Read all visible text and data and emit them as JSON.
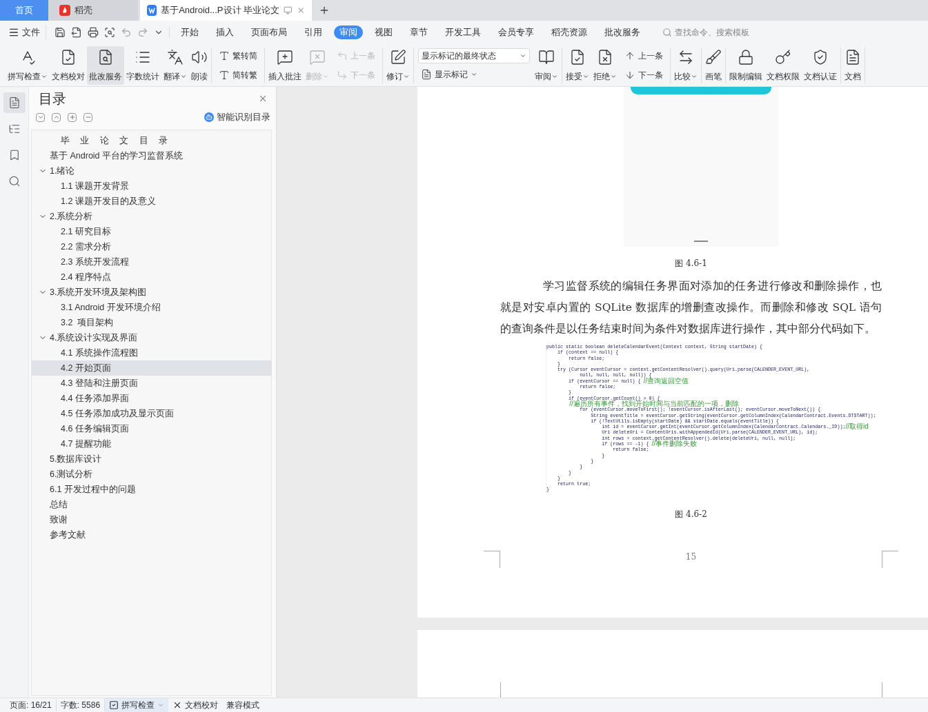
{
  "tabs": [
    {
      "kind": "home",
      "label": "首页",
      "selected": false
    },
    {
      "kind": "app",
      "label": "稻壳",
      "selected": false
    },
    {
      "kind": "document",
      "label": "基于Android...P设计 毕业论文",
      "selected": true
    }
  ],
  "menu": {
    "file": "文件",
    "tabs": [
      {
        "label": "开始",
        "selected": false
      },
      {
        "label": "插入",
        "selected": false
      },
      {
        "label": "页面布局",
        "selected": false
      },
      {
        "label": "引用",
        "selected": false
      },
      {
        "label": "审阅",
        "selected": true
      },
      {
        "label": "视图",
        "selected": false
      },
      {
        "label": "章节",
        "selected": false
      },
      {
        "label": "开发工具",
        "selected": false
      },
      {
        "label": "会员专享",
        "selected": false
      },
      {
        "label": "稻壳资源",
        "selected": false
      },
      {
        "label": "批改服务",
        "selected": false
      }
    ],
    "search_placeholder": "查找命令、搜索模板"
  },
  "ribbon": [
    [
      {
        "kind": "large",
        "label": "拼写检查",
        "dropdown": true,
        "disabled": false,
        "selected": false
      },
      {
        "kind": "large",
        "label": "文档校对",
        "dropdown": false,
        "disabled": false,
        "selected": false
      },
      {
        "kind": "large",
        "label": "批改服务",
        "dropdown": false,
        "disabled": false,
        "selected": true
      },
      {
        "kind": "large",
        "label": "字数统计",
        "dropdown": false,
        "disabled": false,
        "selected": false
      },
      {
        "kind": "large",
        "label": "翻译",
        "dropdown": true,
        "disabled": false,
        "selected": false
      },
      {
        "kind": "large",
        "label": "朗读",
        "dropdown": false,
        "disabled": false,
        "selected": false
      }
    ],
    [
      {
        "kind": "stack",
        "items": [
          {
            "kind": "small",
            "label": "繁转简",
            "dropdown": false,
            "disabled": false
          },
          {
            "kind": "small",
            "label": "简转繁",
            "dropdown": false,
            "disabled": false
          }
        ]
      }
    ],
    [
      {
        "kind": "large",
        "label": "插入批注",
        "dropdown": false,
        "disabled": false,
        "selected": false
      },
      {
        "kind": "large",
        "label": "删除",
        "dropdown": true,
        "disabled": true,
        "selected": false
      },
      {
        "kind": "stack",
        "items": [
          {
            "kind": "small",
            "label": "上一条",
            "dropdown": false,
            "disabled": true
          },
          {
            "kind": "small",
            "label": "下一条",
            "dropdown": false,
            "disabled": true
          }
        ]
      }
    ],
    [
      {
        "kind": "large",
        "label": "修订",
        "dropdown": true,
        "disabled": false,
        "selected": false
      }
    ],
    [
      {
        "kind": "stack",
        "items": [
          {
            "kind": "select",
            "value": "显示标记的最终状态"
          },
          {
            "kind": "small",
            "label": "显示标记",
            "dropdown": true,
            "disabled": false
          }
        ]
      },
      {
        "kind": "large",
        "label": "审阅",
        "dropdown": true,
        "disabled": false,
        "selected": false
      }
    ],
    [
      {
        "kind": "large",
        "label": "接受",
        "dropdown": true,
        "disabled": false,
        "selected": false
      },
      {
        "kind": "large",
        "label": "拒绝",
        "dropdown": true,
        "disabled": false,
        "selected": false
      },
      {
        "kind": "stack",
        "items": [
          {
            "kind": "small",
            "label": "上一条",
            "dropdown": false,
            "disabled": false
          },
          {
            "kind": "small",
            "label": "下一条",
            "dropdown": false,
            "disabled": false
          }
        ]
      }
    ],
    [
      {
        "kind": "large",
        "label": "比较",
        "dropdown": true,
        "disabled": false,
        "selected": false
      }
    ],
    [
      {
        "kind": "large",
        "label": "画笔",
        "dropdown": false,
        "disabled": false,
        "selected": false
      }
    ],
    [
      {
        "kind": "large",
        "label": "限制编辑",
        "dropdown": false,
        "disabled": false,
        "selected": false
      },
      {
        "kind": "large",
        "label": "文档权限",
        "dropdown": false,
        "disabled": false,
        "selected": false
      },
      {
        "kind": "large",
        "label": "文档认证",
        "dropdown": false,
        "disabled": false,
        "selected": false
      }
    ],
    [
      {
        "kind": "large",
        "label": "文档",
        "dropdown": false,
        "disabled": false,
        "selected": false
      }
    ]
  ],
  "sidebar_icons": [
    {
      "selected": true
    },
    {
      "selected": false
    },
    {
      "selected": false
    },
    {
      "selected": false
    }
  ],
  "toc": {
    "title": "目录",
    "smart_link": "智能识别目录",
    "items": [
      {
        "kind": "title",
        "label": "毕 业 论 文 目 录",
        "selected": false
      },
      {
        "kind": "entry",
        "label": "基于 Android 平台的学习监督系统",
        "selected": false
      },
      {
        "kind": "entry",
        "label": "1.绪论",
        "selected": false,
        "expanded": true,
        "children": [
          {
            "kind": "entry",
            "label": "1.1 课题开发背景",
            "selected": false
          },
          {
            "kind": "entry",
            "label": "1.2 课题开发目的及意义",
            "selected": false
          }
        ]
      },
      {
        "kind": "entry",
        "label": "2.系统分析",
        "selected": false,
        "expanded": true,
        "children": [
          {
            "kind": "entry",
            "label": "2.1 研究目标",
            "selected": false
          },
          {
            "kind": "entry",
            "label": "2.2 需求分析",
            "selected": false
          },
          {
            "kind": "entry",
            "label": "2.3 系统开发流程",
            "selected": false
          },
          {
            "kind": "entry",
            "label": "2.4 程序特点",
            "selected": false
          }
        ]
      },
      {
        "kind": "entry",
        "label": "3.系统开发环境及架构图",
        "selected": false,
        "expanded": true,
        "children": [
          {
            "kind": "entry",
            "label": "3.1 Android 开发环境介绍",
            "selected": false
          },
          {
            "kind": "entry",
            "label": "3.2  项目架构",
            "selected": false
          }
        ]
      },
      {
        "kind": "entry",
        "label": "4.系统设计实现及界面",
        "selected": false,
        "expanded": true,
        "children": [
          {
            "kind": "entry",
            "label": "4.1 系统操作流程图",
            "selected": false
          },
          {
            "kind": "entry",
            "label": "4.2 开始页面",
            "selected": true
          },
          {
            "kind": "entry",
            "label": "4.3 登陆和注册页面",
            "selected": false
          },
          {
            "kind": "entry",
            "label": "4.4 任务添加界面",
            "selected": false
          },
          {
            "kind": "entry",
            "label": "4.5 任务添加成功及显示页面",
            "selected": false
          },
          {
            "kind": "entry",
            "label": "4.6 任务编辑页面",
            "selected": false
          },
          {
            "kind": "entry",
            "label": "4.7 提醒功能",
            "selected": false
          }
        ]
      },
      {
        "kind": "entry",
        "label": "5.数据库设计",
        "selected": false
      },
      {
        "kind": "entry",
        "label": "6.测试分析",
        "selected": false
      },
      {
        "kind": "entry",
        "label": "6.1 开发过程中的问题",
        "selected": false
      },
      {
        "kind": "entry",
        "label": "总结",
        "selected": false
      },
      {
        "kind": "entry",
        "label": "致谢",
        "selected": false
      },
      {
        "kind": "entry",
        "label": "参考文献",
        "selected": false
      }
    ]
  },
  "document": {
    "caption_1": "图 4.6-1",
    "paragraph": "学习监督系统的编辑任务界面对添加的任务进行修改和删除操作，也就是对安卓内置的 SQLite 数据库的增删查改操作。而删除和修改 SQL 语句的查询条件是以任务结束时间为条件对数据库进行操作，其中部分代码如下。",
    "code": [
      {
        "code": "public static boolean deleteCalendarEvent(Context context, String startDate) {"
      },
      {
        "code": "    if (context == null) {"
      },
      {
        "code": "        return false;"
      },
      {
        "code": "    }"
      },
      {
        "code": "    try (Cursor eventCursor = context.getContentResolver().query(Uri.parse(CALENDER_EVENT_URL),"
      },
      {
        "code": "            null, null, null, null)) {"
      },
      {
        "code": "        if (eventCursor == null) { ",
        "comment": "//查询返回空值"
      },
      {
        "code": "            return false;"
      },
      {
        "code": "        }"
      },
      {
        "code": "        if (eventCursor.getCount() > 0) {"
      },
      {
        "comment": "            //遍历所有事件，找到开始时间与当前匹配的一项，删除"
      },
      {
        "code": "            for (eventCursor.moveToFirst(); !eventCursor.isAfterLast(); eventCursor.moveToNext()) {"
      },
      {
        "code": "                String eventTitle = eventCursor.getString(eventCursor.getColumnIndex(CalendarContract.Events.DTSTART));"
      },
      {
        "code": "                if (!TextUtils.isEmpty(startDate) && startDate.equals(eventTitle)) {"
      },
      {
        "code": "                    int id = eventCursor.getInt(eventCursor.getColumnIndex(CalendarContract.Calendars._ID));",
        "comment": "//取得id"
      },
      {
        "code": "                    Uri deleteUri = ContentUris.withAppendedId(Uri.parse(CALENDER_EVENT_URL), id);"
      },
      {
        "code": "                    int rows = context.getContentResolver().delete(deleteUri, null, null);"
      },
      {
        "code": "                    if (rows == -1) { ",
        "comment": "//事件删除失败"
      },
      {
        "code": "                        return false;"
      },
      {
        "code": "                    }"
      },
      {
        "code": "                }"
      },
      {
        "code": "            }"
      },
      {
        "code": "        }"
      },
      {
        "code": "    }"
      },
      {
        "code": "    return true;"
      },
      {
        "code": "}"
      }
    ],
    "caption_2": "图 4.6-2",
    "page_number": "15"
  },
  "status_bar": [
    {
      "kind": "text",
      "label": "页面: 16/21"
    },
    {
      "kind": "text",
      "label": "字数: 5586"
    },
    {
      "kind": "button",
      "label": "拼写检查",
      "dropdown": true,
      "selected": true
    },
    {
      "kind": "button",
      "label": "文档校对",
      "dropdown": false,
      "selected": false
    },
    {
      "kind": "text",
      "label": "兼容模式"
    }
  ]
}
